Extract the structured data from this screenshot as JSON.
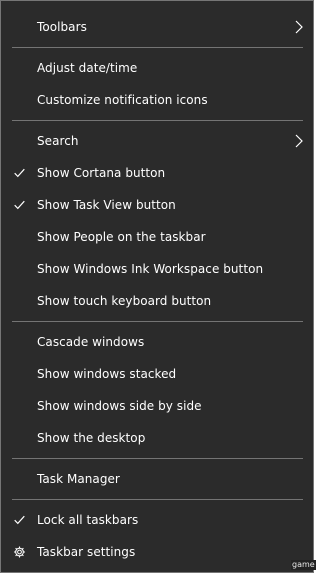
{
  "menu": {
    "items": [
      {
        "label": "Toolbars",
        "submenu": true,
        "checked": false
      },
      {
        "label": "Adjust date/time",
        "submenu": false,
        "checked": false
      },
      {
        "label": "Customize notification icons",
        "submenu": false,
        "checked": false
      },
      {
        "label": "Search",
        "submenu": true,
        "checked": false
      },
      {
        "label": "Show Cortana button",
        "submenu": false,
        "checked": true
      },
      {
        "label": "Show Task View button",
        "submenu": false,
        "checked": true
      },
      {
        "label": "Show People on the taskbar",
        "submenu": false,
        "checked": false
      },
      {
        "label": "Show Windows Ink Workspace button",
        "submenu": false,
        "checked": false
      },
      {
        "label": "Show touch keyboard button",
        "submenu": false,
        "checked": false
      },
      {
        "label": "Cascade windows",
        "submenu": false,
        "checked": false
      },
      {
        "label": "Show windows stacked",
        "submenu": false,
        "checked": false
      },
      {
        "label": "Show windows side by side",
        "submenu": false,
        "checked": false
      },
      {
        "label": "Show the desktop",
        "submenu": false,
        "checked": false
      },
      {
        "label": "Task Manager",
        "submenu": false,
        "checked": false
      },
      {
        "label": "Lock all taskbars",
        "submenu": false,
        "checked": true
      },
      {
        "label": "Taskbar settings",
        "submenu": false,
        "checked": false,
        "icon": "gear-icon"
      }
    ]
  },
  "watermark": "game",
  "colors": {
    "background": "#2b2b2b",
    "border": "#767676",
    "text": "#ffffff",
    "separator": "#747474"
  }
}
